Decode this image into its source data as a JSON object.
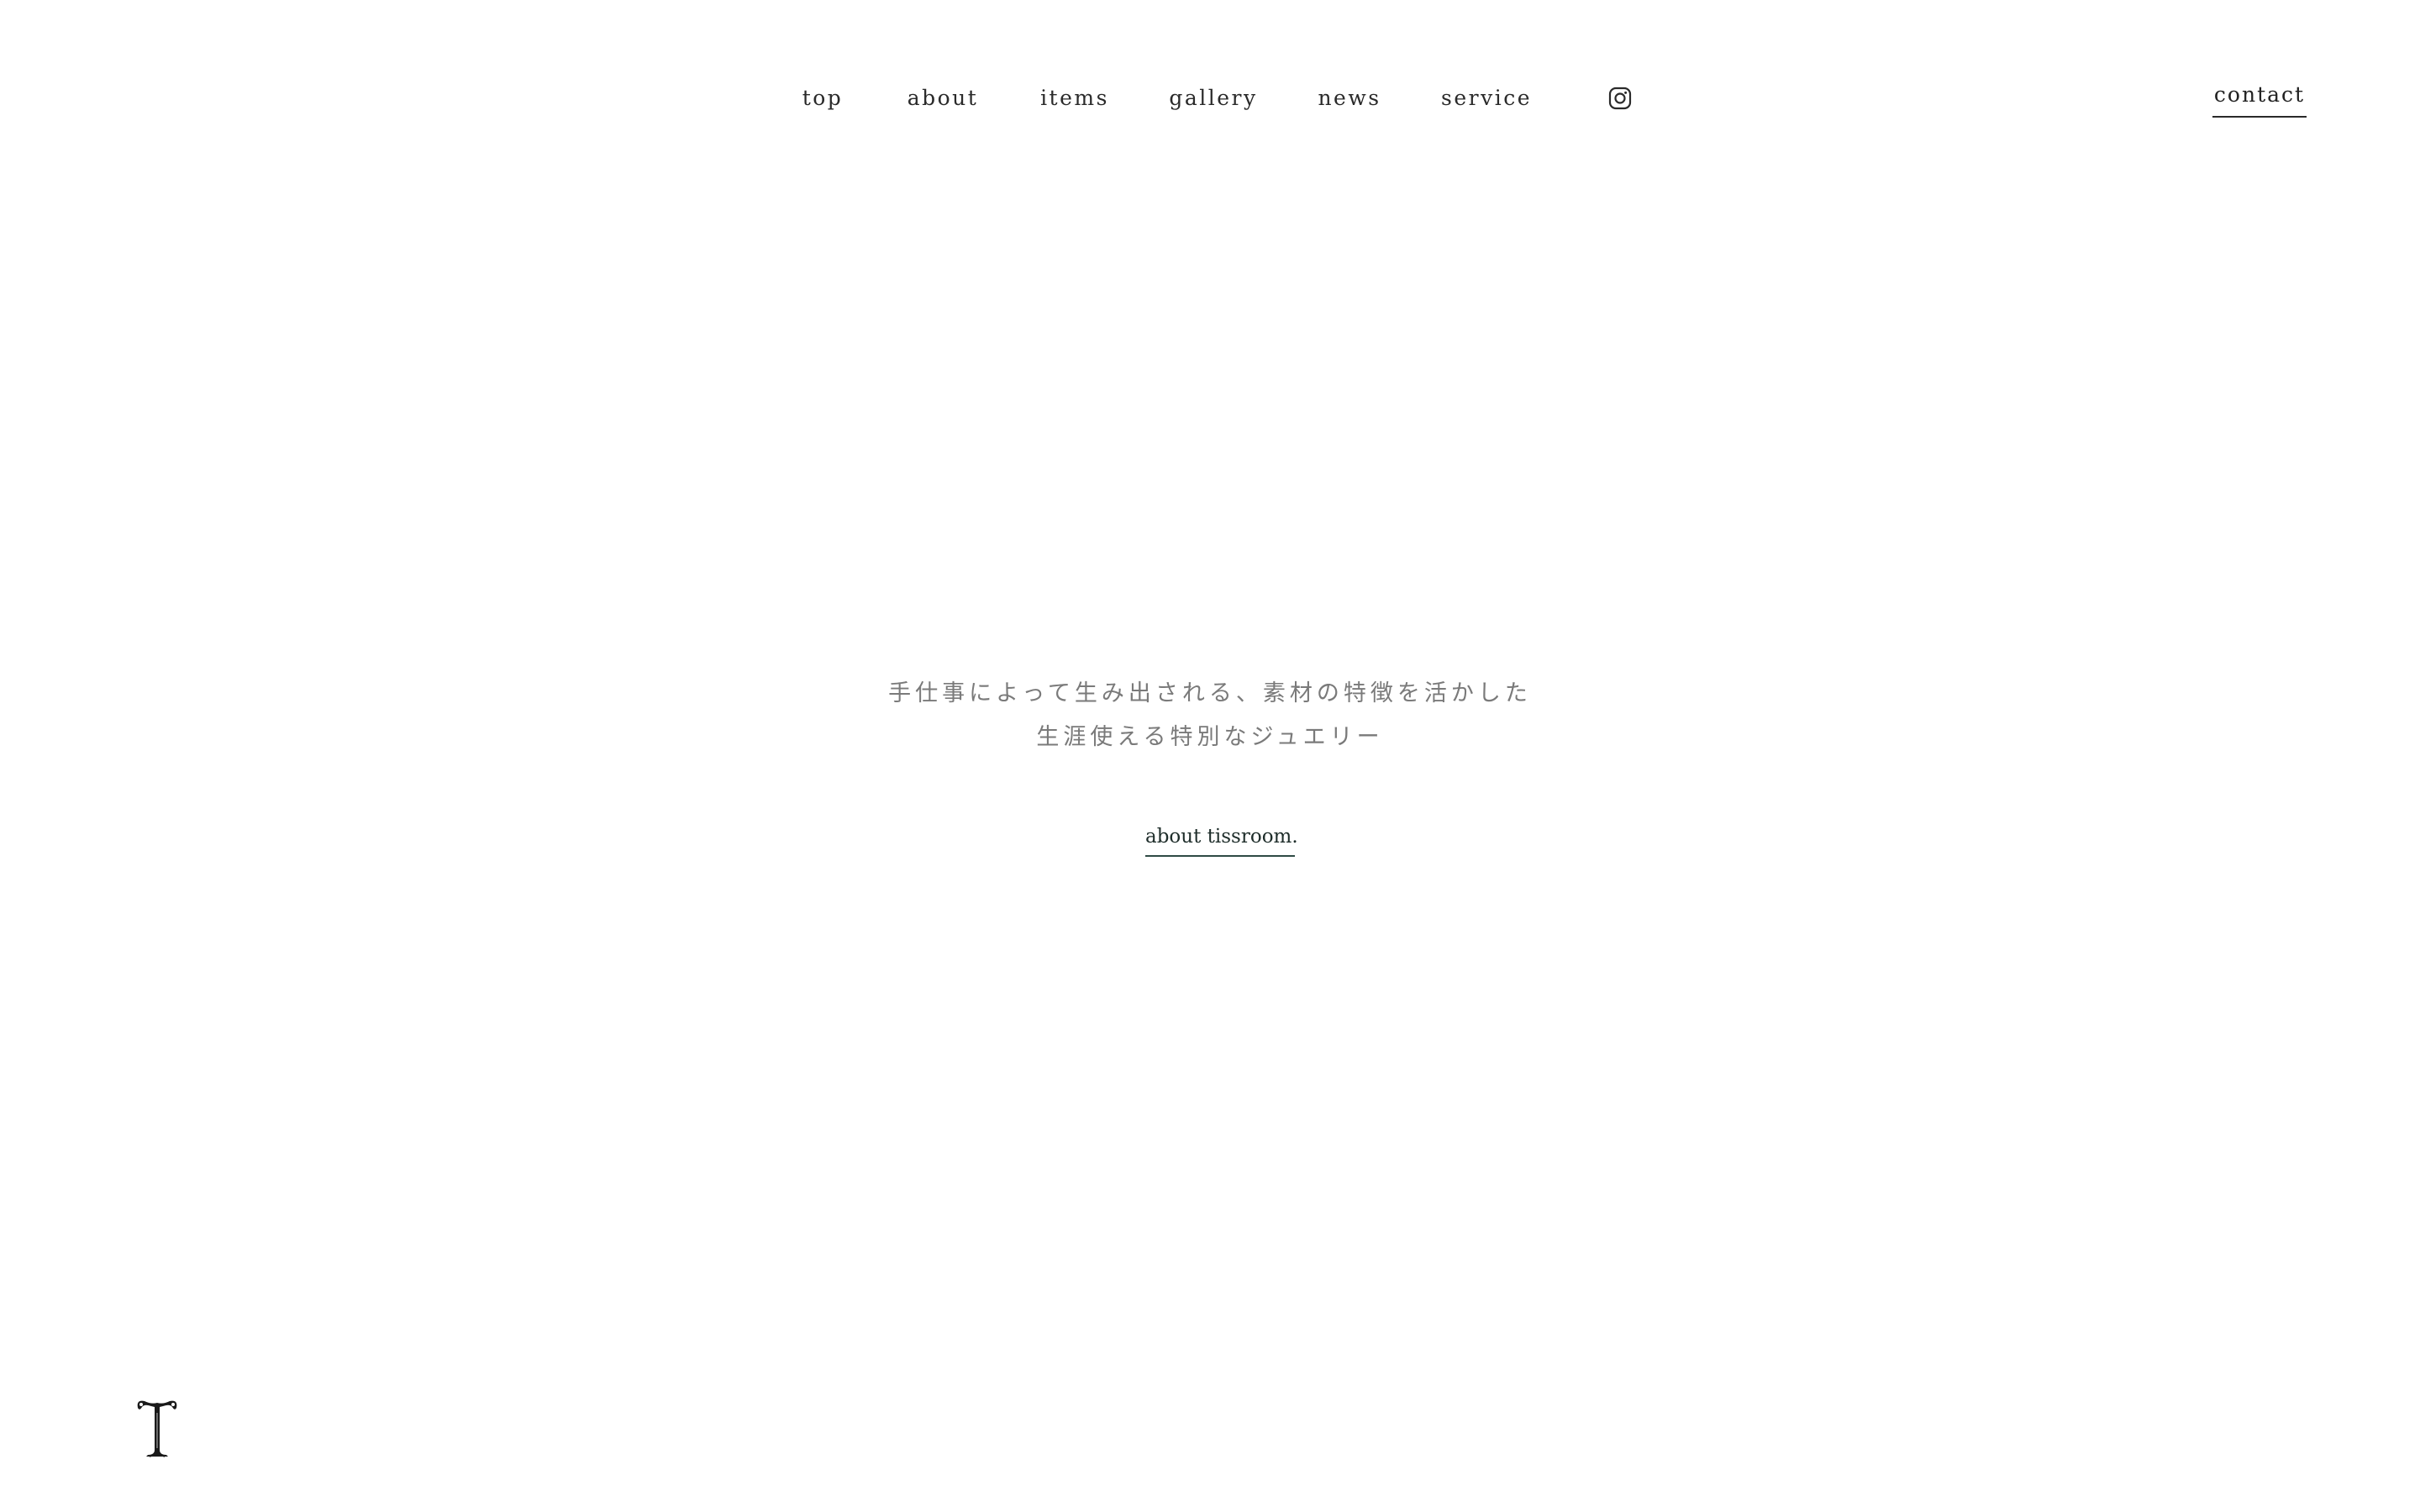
{
  "nav": {
    "items": [
      {
        "label": "top"
      },
      {
        "label": "about"
      },
      {
        "label": "items"
      },
      {
        "label": "gallery"
      },
      {
        "label": "news"
      },
      {
        "label": "service"
      }
    ],
    "instagram_icon": "instagram-icon",
    "contact_label": "contact"
  },
  "hero": {
    "line1": "手仕事によって生み出される、素材の特徴を活かした",
    "line2": "生涯使える特別なジュエリー",
    "link_label": "about tissroom."
  },
  "logo": {
    "letter": "T"
  },
  "colors": {
    "text": "#222222",
    "hero_text": "#7a7a7a",
    "link_underline": "#2f4a45",
    "background": "#ffffff"
  }
}
